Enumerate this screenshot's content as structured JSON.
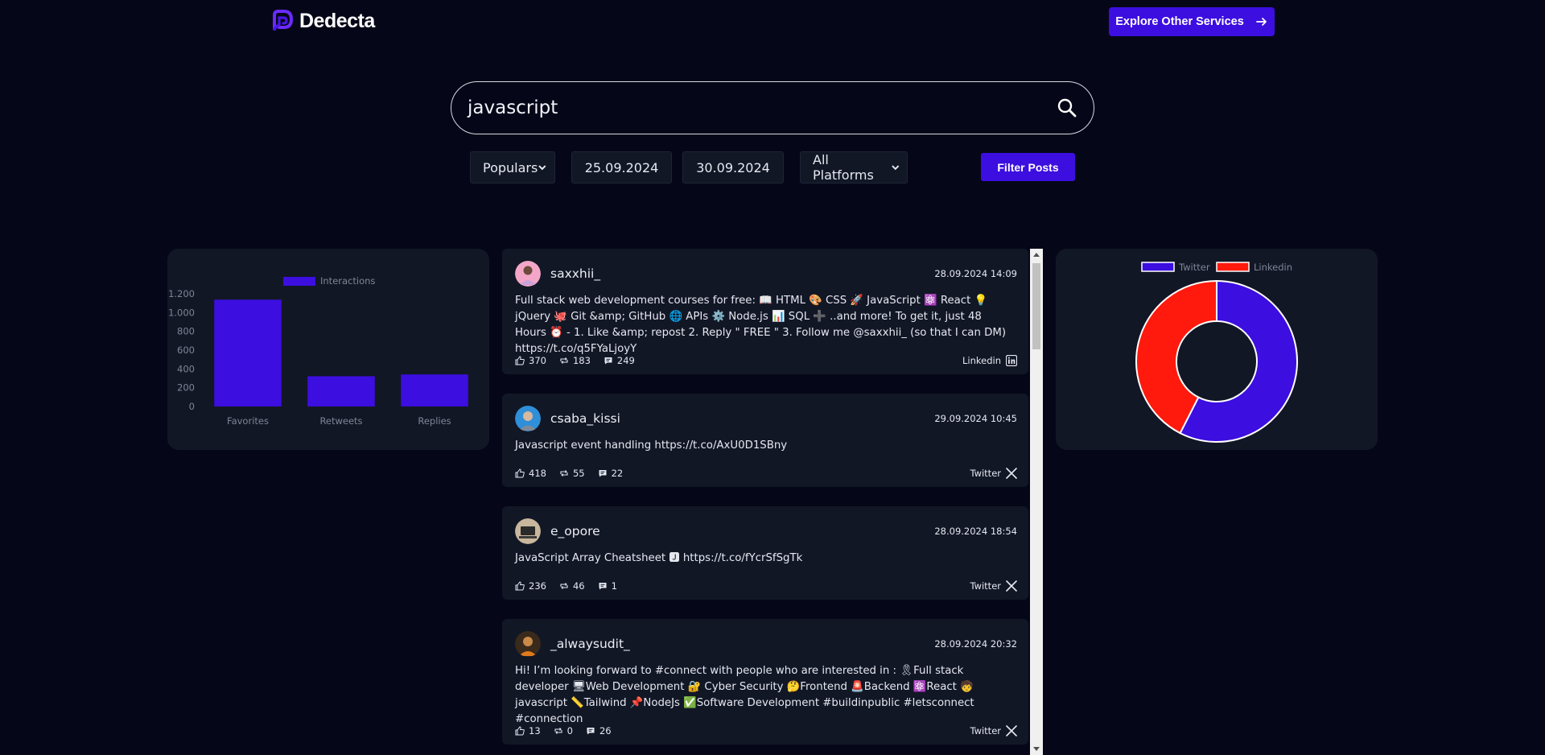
{
  "header": {
    "brand": "Dedecta",
    "explore_label": "Explore Other Services"
  },
  "search": {
    "value": "javascript"
  },
  "filters": {
    "sort": "Populars",
    "start_date": "25.09.2024",
    "end_date": "30.09.2024",
    "platform": "All Platforms",
    "submit_label": "Filter Posts"
  },
  "colors": {
    "accent": "#3c0ee0",
    "twitter": "#3c0ee0",
    "linkedin": "#ff1a0d"
  },
  "chart_data": [
    {
      "type": "bar",
      "categories": [
        "Favorites",
        "Retweets",
        "Replies"
      ],
      "series": [
        {
          "name": "Interactions",
          "values": [
            1137,
            322,
            341
          ]
        }
      ],
      "y_ticks": [
        "0",
        "200",
        "400",
        "600",
        "800",
        "1.000",
        "1.200"
      ],
      "ylim": [
        0,
        1200
      ],
      "legend_position": "top"
    },
    {
      "type": "pie",
      "variant": "doughnut",
      "labels": [
        "Twitter",
        "Linkedin"
      ],
      "values": [
        57.5,
        42.5
      ],
      "legend_position": "top"
    }
  ],
  "posts": [
    {
      "username": "saxxhii_",
      "date": "28.09.2024 14:09",
      "text": "Full stack web development courses for free: 📖 HTML 🎨 CSS 🚀 JavaScript ⚛️ React 💡 jQuery 🐙 Git &amp; GitHub 🌐 APIs ⚙️ Node.js 📊 SQL ➕ ..and more! To get it, just 48 Hours ⏰ - 1. Like &amp; repost 2. Reply \" FREE \" 3. Follow me @saxxhii_ (so that I can DM) https://t.co/q5FYaLjoyY",
      "likes": "370",
      "reposts": "183",
      "comments": "249",
      "platform": "Linkedin",
      "avatar_icon": "avatar-woman-icon"
    },
    {
      "username": "csaba_kissi",
      "date": "29.09.2024 10:45",
      "text": "Javascript event handling https://t.co/AxU0D1SBny",
      "likes": "418",
      "reposts": "55",
      "comments": "22",
      "platform": "Twitter",
      "avatar_icon": "avatar-man-icon"
    },
    {
      "username": "e_opore",
      "date": "28.09.2024 18:54",
      "text": "JavaScript Array Cheatsheet 🅹 https://t.co/fYcrSfSgTk",
      "likes": "236",
      "reposts": "46",
      "comments": "1",
      "platform": "Twitter",
      "avatar_icon": "avatar-workspace-icon"
    },
    {
      "username": "_alwaysudit_",
      "date": "28.09.2024 20:32",
      "text": "Hi! I’m looking forward to #connect with people who are interested in : 🎗Full stack developer 🖥Web Development 🔐 Cyber Security 🤔Frontend 🚨Backend ⚛️React 🧒javascript 📏Tailwind 📌NodeJs ✅Software Development #buildinpublic #letsconnect #connection",
      "likes": "13",
      "reposts": "0",
      "comments": "26",
      "platform": "Twitter",
      "avatar_icon": "avatar-portrait-icon"
    }
  ]
}
